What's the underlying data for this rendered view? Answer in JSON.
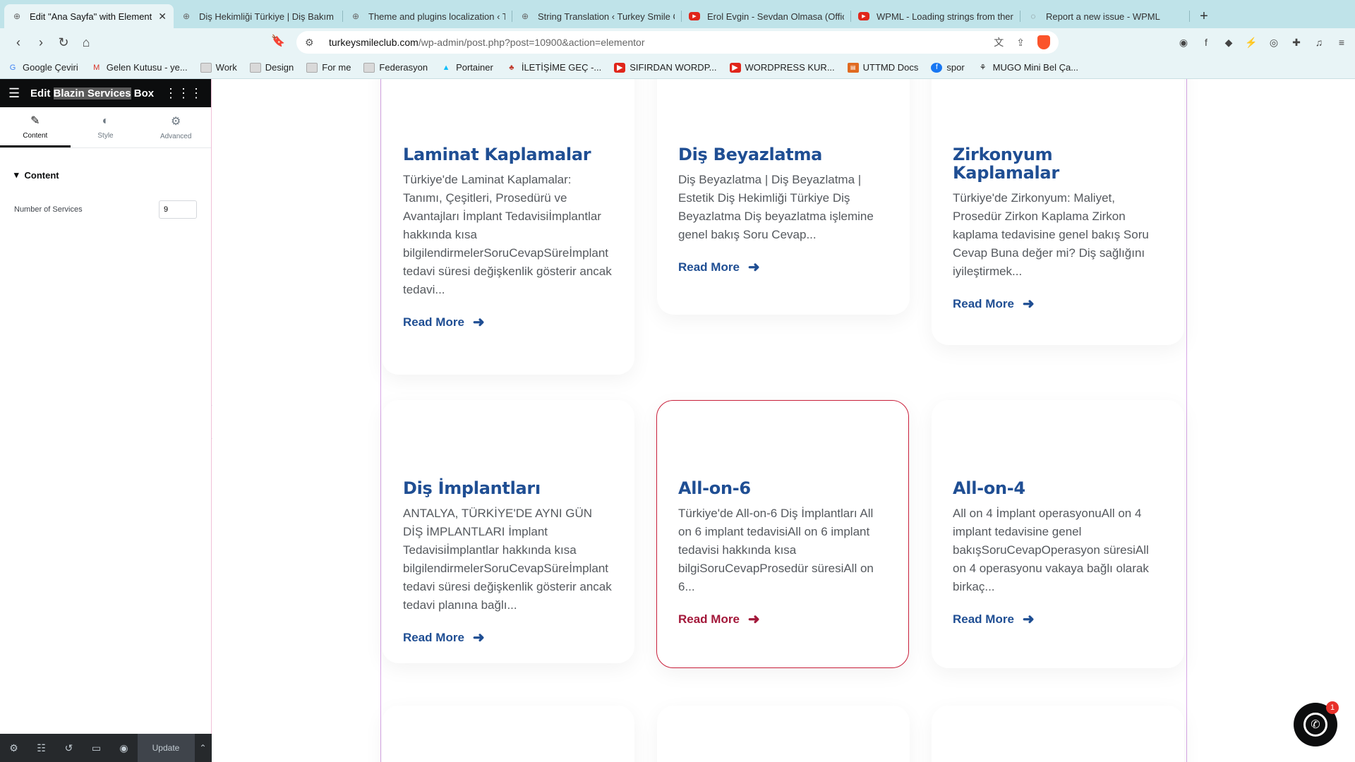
{
  "browser": {
    "tabs": [
      {
        "title": "Edit \"Ana Sayfa\" with Element",
        "icon": "wordpress-icon",
        "active": true
      },
      {
        "title": "Diş Hekimliği Türkiye | Diş Bakım",
        "icon": "wordpress-icon"
      },
      {
        "title": "Theme and plugins localization ‹ T",
        "icon": "wordpress-icon"
      },
      {
        "title": "String Translation ‹ Turkey Smile C",
        "icon": "wordpress-icon"
      },
      {
        "title": "Erol Evgin - Sevdan Olmasa (Offic",
        "icon": "youtube-icon"
      },
      {
        "title": "WPML - Loading strings from ther",
        "icon": "youtube-icon"
      },
      {
        "title": "Report a new issue - WPML",
        "icon": "wpml-icon"
      }
    ],
    "url_host": "turkeysmileclub.com",
    "url_path": "/wp-admin/post.php?post=10900&action=elementor",
    "bookmarks": [
      {
        "label": "Google Çeviri",
        "icon": "translate-icon"
      },
      {
        "label": "Gelen Kutusu - ye...",
        "icon": "gmail-icon"
      },
      {
        "label": "Work",
        "icon": "folder-icon"
      },
      {
        "label": "Design",
        "icon": "folder-icon"
      },
      {
        "label": "For me",
        "icon": "folder-icon"
      },
      {
        "label": "Federasyon",
        "icon": "folder-icon"
      },
      {
        "label": "Portainer",
        "icon": "portainer-icon"
      },
      {
        "label": "İLETİŞİME GEÇ -...",
        "icon": "site-icon"
      },
      {
        "label": "SIFIRDAN WORDP...",
        "icon": "youtube-icon"
      },
      {
        "label": "WORDPRESS KUR...",
        "icon": "youtube-icon"
      },
      {
        "label": "UTTMD Docs",
        "icon": "docs-icon"
      },
      {
        "label": "spor",
        "icon": "facebook-icon"
      },
      {
        "label": "MUGO Mini Bel Ça...",
        "icon": "site-icon"
      }
    ]
  },
  "panel": {
    "title_prefix": "Edit ",
    "title_widget": "Blazin Services",
    "title_suffix": " Box",
    "tabs": [
      {
        "label": "Content",
        "icon": "pencil-icon"
      },
      {
        "label": "Style",
        "icon": "contrast-icon"
      },
      {
        "label": "Advanced",
        "icon": "gear-icon"
      }
    ],
    "section_label": "Content",
    "control_label": "Number of Services",
    "control_value": "9",
    "update_label": "Update"
  },
  "cards": [
    {
      "title": "Laminat Kaplamalar",
      "text": "Türkiye'de Laminat Kaplamalar: Tanımı, Çeşitleri, Prosedürü ve Avantajları İmplant Tedavisiİmplantlar hakkında kısa bilgilendirmelerSoruCevapSüreİmplant tedavi süresi değişkenlik gösterir ancak tedavi...",
      "link": "Read More"
    },
    {
      "title": "Diş Beyazlatma",
      "text": "Diş Beyazlatma | Diş Beyazlatma | Estetik Diş Hekimliği Türkiye Diş Beyazlatma Diş beyazlatma işlemine genel bakış Soru Cevap...",
      "link": "Read More"
    },
    {
      "title": "Zirkonyum Kaplamalar",
      "text": "Türkiye'de Zirkonyum: Maliyet, Prosedür Zirkon Kaplama Zirkon kaplama tedavisine genel bakış Soru Cevap Buna değer mi? Diş sağlığını iyileştirmek...",
      "link": "Read More"
    },
    {
      "title": "Diş İmplantları",
      "text": "ANTALYA, TÜRKİYE'DE AYNI GÜN DİŞ İMPLANTLARI İmplant Tedavisiİmplantlar hakkında kısa bilgilendirmelerSoruCevapSüreİmplant tedavi süresi değişkenlik gösterir ancak tedavi planına bağlı...",
      "link": "Read More"
    },
    {
      "title": "All-on-6",
      "text": "Türkiye'de All-on-6 Diş İmplantları All on 6 implant tedavisiAll on 6 implant tedavisi hakkında kısa bilgiSoruCevapProsedür süresiAll on 6...",
      "link": "Read More"
    },
    {
      "title": "All-on-4",
      "text": "All on 4 İmplant operasyonuAll on 4 implant tedavisine genel bakışSoruCevapOperasyon süresiAll on 4 operasyonu vakaya bağlı olarak birkaç...",
      "link": "Read More"
    }
  ],
  "whatsapp_badge": "1",
  "colors": {
    "accent": "#1f4e93",
    "hover_border": "#c9203b",
    "hover_link": "#a3183a"
  }
}
